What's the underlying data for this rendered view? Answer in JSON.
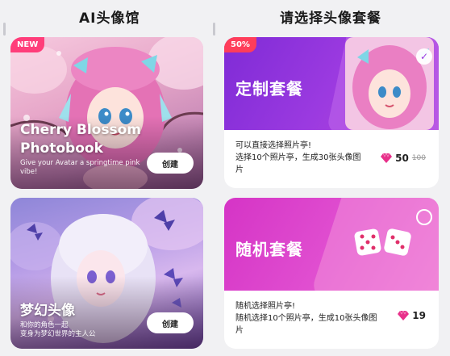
{
  "left_column": {
    "title": "AI头像馆",
    "cards": [
      {
        "badge": "NEW",
        "title_line1": "Cherry Blossom",
        "title_line2": "Photobook",
        "desc_line1": "Give your Avatar a springtime pink",
        "desc_line2": "vibe!",
        "button": "创建"
      },
      {
        "title": "梦幻头像",
        "desc_line1": "和你的角色一起",
        "desc_line2": "变身为梦幻世界的主人公",
        "button": "创建"
      }
    ]
  },
  "right_column": {
    "title": "请选择头像套餐",
    "packages": [
      {
        "badge": "50%",
        "title": "定制套餐",
        "selected": true,
        "line1": "可以直接选择照片亭!",
        "line2": "选择10个照片亭，生成30张头像图",
        "line3": "片",
        "price": "50",
        "old_price": "100"
      },
      {
        "title": "随机套餐",
        "selected": false,
        "line1": "随机选择照片亭!",
        "line2": "随机选择10个照片亭，生成10张头像图",
        "line3": "片",
        "price": "19"
      }
    ]
  },
  "colors": {
    "accent_pink": "#ff3d7a",
    "gem": "#e8308a",
    "custom_banner": "#9b3ae0",
    "random_banner": "#e04ed0"
  }
}
